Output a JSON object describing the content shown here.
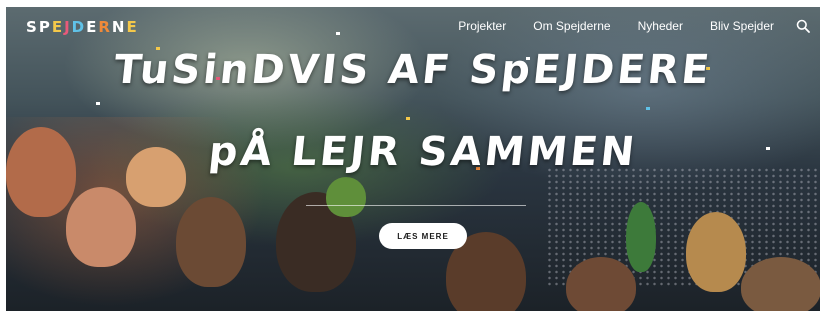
{
  "header": {
    "logo_text": "SPEJDERNE",
    "logo_letter_colors": [
      "#ffffff",
      "#ffffff",
      "#f4c84a",
      "#e85a7a",
      "#60c2e8",
      "#ffffff",
      "#f08a3a",
      "#ffffff",
      "#f4c84a"
    ]
  },
  "nav": {
    "items": [
      "Projekter",
      "Om Spejderne",
      "Nyheder",
      "Bliv Spejder"
    ],
    "search_icon": "search-icon"
  },
  "hero": {
    "line1": "TuSinDVIS AF SpEJDERE",
    "line2": "pÅ LEJR SAMMEN",
    "cta_label": "LÆS MERE",
    "image": "festival crowd of scouts with confetti"
  }
}
